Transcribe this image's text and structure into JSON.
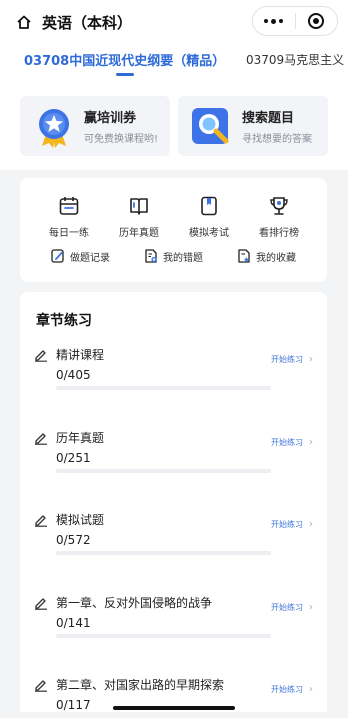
{
  "header": {
    "title": "英语（本科）"
  },
  "tabs": [
    {
      "label": "03708中国近现代史纲要（精品）"
    },
    {
      "label": "03709马克思主义"
    }
  ],
  "promos": [
    {
      "title": "赢培训券",
      "subtitle": "可免费换课程哟!"
    },
    {
      "title": "搜索题目",
      "subtitle": "寻找想要的答案"
    }
  ],
  "menu": {
    "row1": [
      {
        "label": "每日一练",
        "icon": "calendar-icon"
      },
      {
        "label": "历年真题",
        "icon": "book-icon"
      },
      {
        "label": "模拟考试",
        "icon": "bookmark-icon"
      },
      {
        "label": "看排行榜",
        "icon": "trophy-icon"
      }
    ],
    "row2": [
      {
        "label": "做题记录",
        "icon": "edit-record-icon"
      },
      {
        "label": "我的错题",
        "icon": "wrong-doc-icon"
      },
      {
        "label": "我的收藏",
        "icon": "favorite-doc-icon"
      }
    ]
  },
  "chapters": {
    "title": "章节练习",
    "start_label": "开始练习",
    "items": [
      {
        "name": "精讲课程",
        "progress": "0/405",
        "done_fraction": 0
      },
      {
        "name": "历年真题",
        "progress": "0/251",
        "done_fraction": 0
      },
      {
        "name": "模拟试题",
        "progress": "0/572",
        "done_fraction": 0
      },
      {
        "name": "第一章、反对外国侵略的战争",
        "progress": "0/141",
        "done_fraction": 0
      },
      {
        "name": "第二章、对国家出路的早期探索",
        "progress": "0/117",
        "done_fraction": 0
      }
    ]
  },
  "colors": {
    "accent": "#2f6bd8",
    "background": "#f3f4f6"
  }
}
